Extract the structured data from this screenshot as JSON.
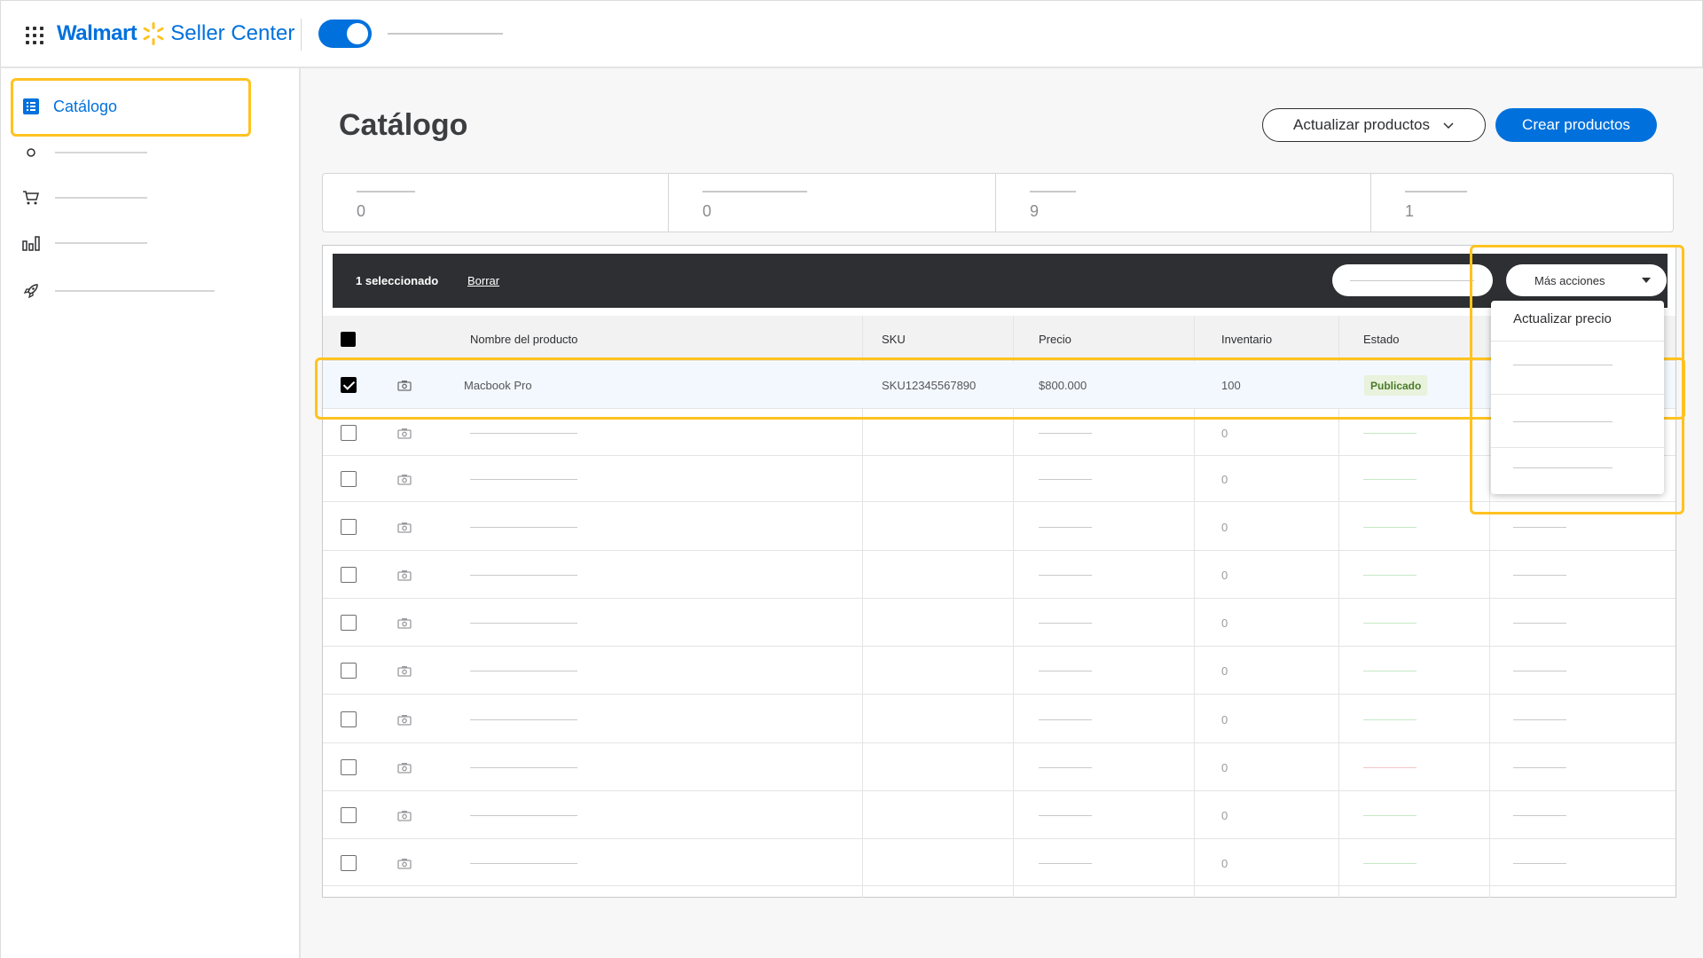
{
  "header": {
    "logo_walmart": "Walmart",
    "logo_seller": "Seller Center",
    "brand_color": "#0071dc",
    "spark_color": "#ffc220"
  },
  "sidebar": {
    "active_label": "Catálogo",
    "items": [
      {
        "icon": "circle-icon"
      },
      {
        "icon": "cart-icon"
      },
      {
        "icon": "bar-chart-icon"
      },
      {
        "icon": "rocket-icon"
      }
    ]
  },
  "main": {
    "title": "Catálogo",
    "update_button": "Actualizar productos",
    "create_button": "Crear productos",
    "stats": [
      "0",
      "0",
      "9",
      "1"
    ]
  },
  "bulk": {
    "selected": "1 seleccionado",
    "clear": "Borrar",
    "more_actions": "Más acciones"
  },
  "table": {
    "headers": [
      "Nombre del producto",
      "SKU",
      "Precio",
      "Inventario",
      "Estado"
    ],
    "selected_row": {
      "name": "Macbook Pro",
      "sku": "SKU12345567890",
      "price": "$800.000",
      "inventory": "100",
      "status": "Publicado"
    },
    "placeholder_inventory": [
      "0",
      "0",
      "0",
      "0",
      "0",
      "0",
      "0",
      "0",
      "0",
      "0"
    ]
  },
  "dropdown": {
    "first_item": "Actualizar precio"
  },
  "colors": {
    "highlight": "#ffc220",
    "dark_bar": "#2e2f32",
    "badge_bg": "#e8f2dc"
  }
}
